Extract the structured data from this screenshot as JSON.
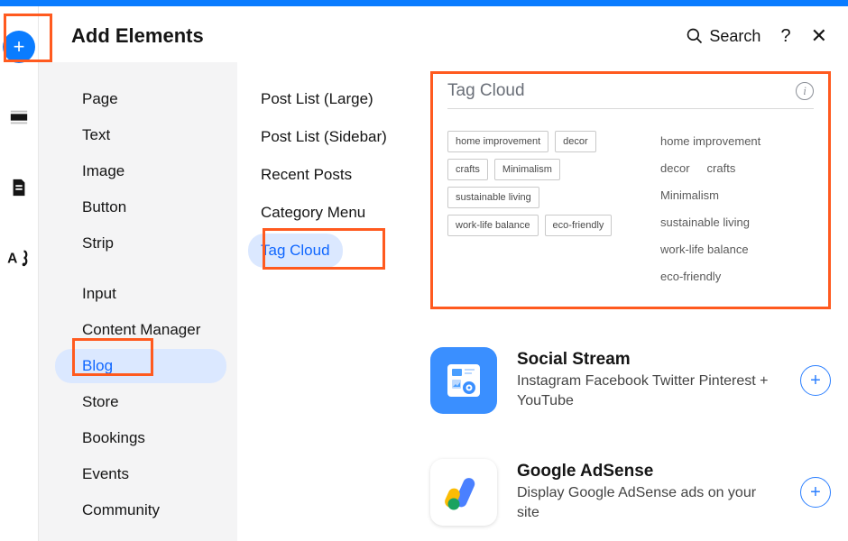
{
  "header": {
    "title": "Add Elements",
    "search": "Search",
    "help": "?",
    "close": "✕"
  },
  "categories": {
    "group1": [
      "Page",
      "Text",
      "Image",
      "Button",
      "Strip"
    ],
    "group2": [
      "Input",
      "Content Manager",
      "Blog",
      "Store",
      "Bookings",
      "Events",
      "Community"
    ],
    "selected": "Blog"
  },
  "subcategories": {
    "items": [
      "Post List (Large)",
      "Post List (Sidebar)",
      "Recent Posts",
      "Category Menu",
      "Tag Cloud"
    ],
    "selected": "Tag Cloud"
  },
  "tagcloud": {
    "title": "Tag Cloud",
    "tags": [
      "home improvement",
      "decor",
      "crafts",
      "Minimalism",
      "sustainable living",
      "work-life balance",
      "eco-friendly"
    ]
  },
  "apps": {
    "social": {
      "name": "Social Stream",
      "desc": "Instagram Facebook Twitter Pinterest + YouTube"
    },
    "adsense": {
      "name": "Google AdSense",
      "desc": "Display Google AdSense ads on your site"
    }
  }
}
